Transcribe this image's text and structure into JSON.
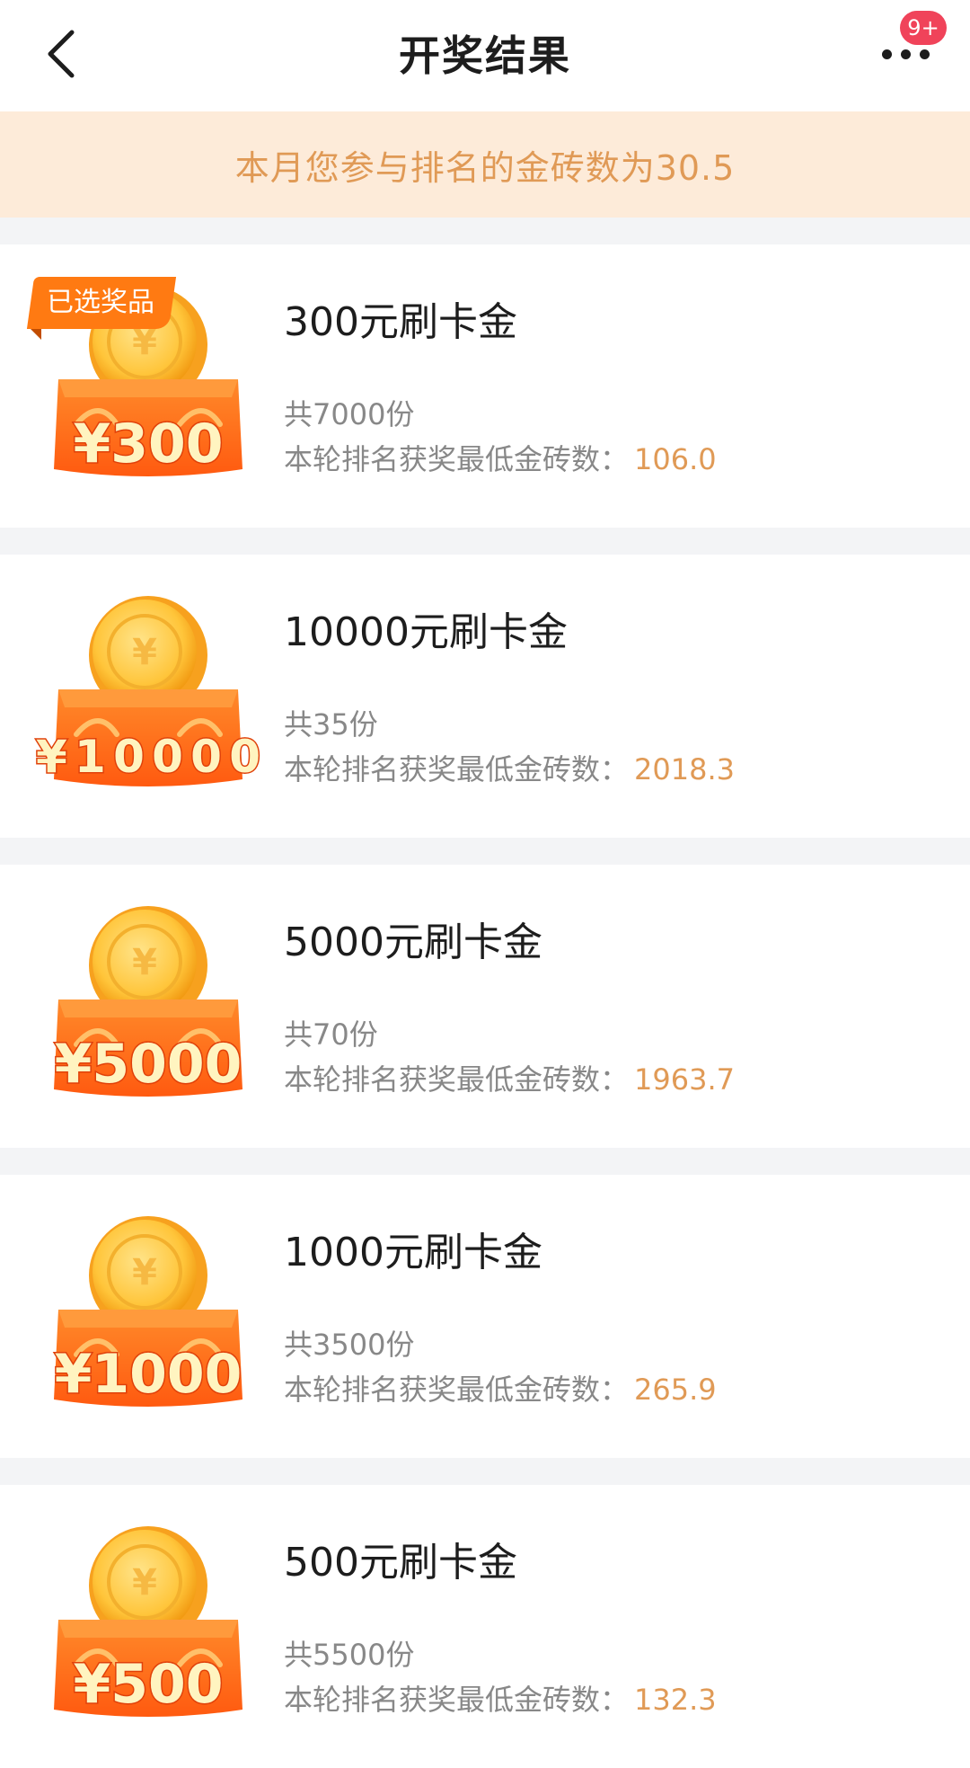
{
  "header": {
    "title": "开奖结果",
    "badge": "9+"
  },
  "notice": {
    "text": "本月您参与排名的金砖数为30.5"
  },
  "colors": {
    "accent": "#e09a56",
    "notice_bg": "#fdebd9",
    "badge": "#f0435a",
    "tag": "#ff7a12"
  },
  "threshold_label": "本轮排名获奖最低金砖数：",
  "prizes": [
    {
      "amount_label": "¥300",
      "name": "300元刷卡金",
      "count": "共7000份",
      "min_bricks": "106.0",
      "tag": "已选奖品"
    },
    {
      "amount_label": "¥10000",
      "name": "10000元刷卡金",
      "count": "共35份",
      "min_bricks": "2018.3"
    },
    {
      "amount_label": "¥5000",
      "name": "5000元刷卡金",
      "count": "共70份",
      "min_bricks": "1963.7"
    },
    {
      "amount_label": "¥1000",
      "name": "1000元刷卡金",
      "count": "共3500份",
      "min_bricks": "265.9"
    },
    {
      "amount_label": "¥500",
      "name": "500元刷卡金",
      "count": "共5500份",
      "min_bricks": "132.3"
    }
  ]
}
